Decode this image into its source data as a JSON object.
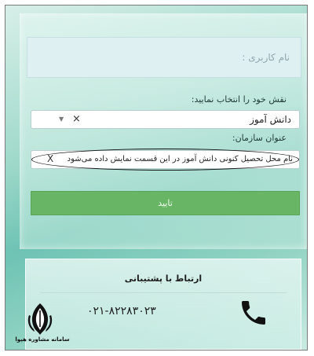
{
  "login_form": {
    "username_placeholder": "نام کاربری :",
    "role_label": "نقش خود را انتخاب نمایید:",
    "role_value": "دانش آموز",
    "clear_symbol": "×",
    "dropdown_symbol": "▼",
    "org_label": "عنوان سازمان:",
    "org_value": "نام محل تحصیل کنونی دانش آموز در این قسمت نمایش داده می‌شود",
    "org_clear_symbol": "X",
    "submit_label": "تایید"
  },
  "support": {
    "title": "ارتباط با پشتیبانی",
    "phone": "۰۲۱-۸۲۲۸۳۰۲۳"
  },
  "watermark": {
    "brand": "سامانه مشاوره هپوا"
  },
  "colors": {
    "accent": "#68b566",
    "background": "#8fd2c2"
  }
}
